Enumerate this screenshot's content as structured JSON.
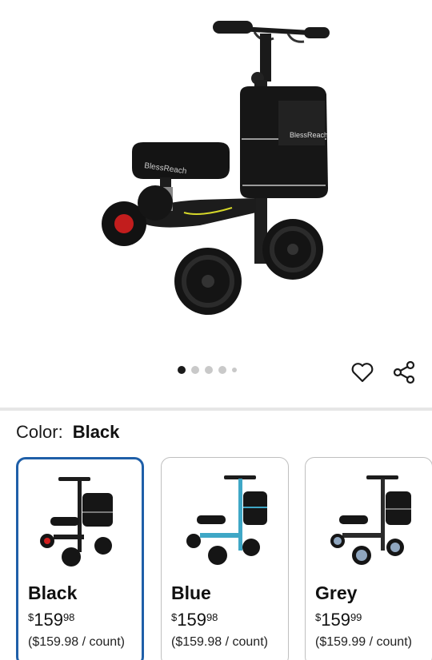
{
  "product": {
    "brand_on_image": "BlessReach",
    "gallery_dots": 5,
    "active_image": 1
  },
  "actions": {
    "favorite_icon": "heart-outline-icon",
    "share_icon": "share-icon"
  },
  "color": {
    "label": "Color:",
    "selected": "Black"
  },
  "variants": [
    {
      "name": "Black",
      "currency": "$",
      "whole": "159",
      "cents": "98",
      "unit_price": "($159.98 / count)",
      "frame_color": "#1c1c1c",
      "accent": "#d21f1f"
    },
    {
      "name": "Blue",
      "currency": "$",
      "whole": "159",
      "cents": "98",
      "unit_price": "($159.98 / count)",
      "frame_color": "#3fa7c6",
      "accent": "#1c1c1c"
    },
    {
      "name": "Grey",
      "currency": "$",
      "whole": "159",
      "cents": "99",
      "unit_price": "($159.99 / count)",
      "frame_color": "#2a2a2a",
      "accent": "#8fa6bf"
    }
  ],
  "colors": {
    "selected_border": "#1f5fa8",
    "divider": "#e6e6e6"
  }
}
